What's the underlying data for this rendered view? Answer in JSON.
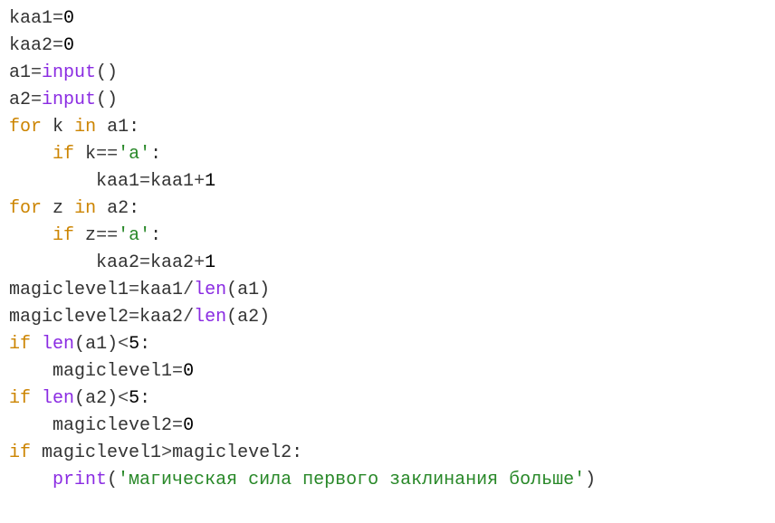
{
  "code": {
    "lines": [
      {
        "indent": 0,
        "tokens": [
          {
            "t": "kaa1",
            "c": "var"
          },
          {
            "t": "=",
            "c": "op"
          },
          {
            "t": "0",
            "c": "num"
          }
        ]
      },
      {
        "indent": 0,
        "tokens": [
          {
            "t": "kaa2",
            "c": "var"
          },
          {
            "t": "=",
            "c": "op"
          },
          {
            "t": "0",
            "c": "num"
          }
        ]
      },
      {
        "indent": 0,
        "tokens": [
          {
            "t": "a1",
            "c": "var"
          },
          {
            "t": "=",
            "c": "op"
          },
          {
            "t": "input",
            "c": "func"
          },
          {
            "t": "()",
            "c": "punc"
          }
        ]
      },
      {
        "indent": 0,
        "tokens": [
          {
            "t": "a2",
            "c": "var"
          },
          {
            "t": "=",
            "c": "op"
          },
          {
            "t": "input",
            "c": "func"
          },
          {
            "t": "()",
            "c": "punc"
          }
        ]
      },
      {
        "indent": 0,
        "tokens": [
          {
            "t": "for",
            "c": "kw"
          },
          {
            "t": " ",
            "c": "var"
          },
          {
            "t": "k",
            "c": "var"
          },
          {
            "t": " ",
            "c": "var"
          },
          {
            "t": "in",
            "c": "kw"
          },
          {
            "t": " ",
            "c": "var"
          },
          {
            "t": "a1",
            "c": "var"
          },
          {
            "t": ":",
            "c": "punc"
          }
        ]
      },
      {
        "indent": 1,
        "tokens": [
          {
            "t": "if",
            "c": "kw"
          },
          {
            "t": " ",
            "c": "var"
          },
          {
            "t": "k",
            "c": "var"
          },
          {
            "t": "==",
            "c": "op"
          },
          {
            "t": "'a'",
            "c": "str"
          },
          {
            "t": ":",
            "c": "punc"
          }
        ]
      },
      {
        "indent": 2,
        "tokens": [
          {
            "t": "kaa1",
            "c": "var"
          },
          {
            "t": "=",
            "c": "op"
          },
          {
            "t": "kaa1",
            "c": "var"
          },
          {
            "t": "+",
            "c": "op"
          },
          {
            "t": "1",
            "c": "num"
          }
        ]
      },
      {
        "indent": 0,
        "tokens": [
          {
            "t": "for",
            "c": "kw"
          },
          {
            "t": " ",
            "c": "var"
          },
          {
            "t": "z",
            "c": "var"
          },
          {
            "t": " ",
            "c": "var"
          },
          {
            "t": "in",
            "c": "kw"
          },
          {
            "t": " ",
            "c": "var"
          },
          {
            "t": "a2",
            "c": "var"
          },
          {
            "t": ":",
            "c": "punc"
          }
        ]
      },
      {
        "indent": 1,
        "tokens": [
          {
            "t": "if",
            "c": "kw"
          },
          {
            "t": " ",
            "c": "var"
          },
          {
            "t": "z",
            "c": "var"
          },
          {
            "t": "==",
            "c": "op"
          },
          {
            "t": "'a'",
            "c": "str"
          },
          {
            "t": ":",
            "c": "punc"
          }
        ]
      },
      {
        "indent": 2,
        "tokens": [
          {
            "t": "kaa2",
            "c": "var"
          },
          {
            "t": "=",
            "c": "op"
          },
          {
            "t": "kaa2",
            "c": "var"
          },
          {
            "t": "+",
            "c": "op"
          },
          {
            "t": "1",
            "c": "num"
          }
        ]
      },
      {
        "indent": 0,
        "tokens": [
          {
            "t": "magiclevel1",
            "c": "var"
          },
          {
            "t": "=",
            "c": "op"
          },
          {
            "t": "kaa1",
            "c": "var"
          },
          {
            "t": "/",
            "c": "op"
          },
          {
            "t": "len",
            "c": "func"
          },
          {
            "t": "(",
            "c": "punc"
          },
          {
            "t": "a1",
            "c": "var"
          },
          {
            "t": ")",
            "c": "punc"
          }
        ]
      },
      {
        "indent": 0,
        "tokens": [
          {
            "t": "magiclevel2",
            "c": "var"
          },
          {
            "t": "=",
            "c": "op"
          },
          {
            "t": "kaa2",
            "c": "var"
          },
          {
            "t": "/",
            "c": "op"
          },
          {
            "t": "len",
            "c": "func"
          },
          {
            "t": "(",
            "c": "punc"
          },
          {
            "t": "a2",
            "c": "var"
          },
          {
            "t": ")",
            "c": "punc"
          }
        ]
      },
      {
        "indent": 0,
        "tokens": [
          {
            "t": "if",
            "c": "kw"
          },
          {
            "t": " ",
            "c": "var"
          },
          {
            "t": "len",
            "c": "func"
          },
          {
            "t": "(",
            "c": "punc"
          },
          {
            "t": "a1",
            "c": "var"
          },
          {
            "t": ")",
            "c": "punc"
          },
          {
            "t": "<",
            "c": "op"
          },
          {
            "t": "5",
            "c": "num"
          },
          {
            "t": ":",
            "c": "punc"
          }
        ]
      },
      {
        "indent": 1,
        "tokens": [
          {
            "t": "magiclevel1",
            "c": "var"
          },
          {
            "t": "=",
            "c": "op"
          },
          {
            "t": "0",
            "c": "num"
          }
        ]
      },
      {
        "indent": 0,
        "tokens": [
          {
            "t": "if",
            "c": "kw"
          },
          {
            "t": " ",
            "c": "var"
          },
          {
            "t": "len",
            "c": "func"
          },
          {
            "t": "(",
            "c": "punc"
          },
          {
            "t": "a2",
            "c": "var"
          },
          {
            "t": ")",
            "c": "punc"
          },
          {
            "t": "<",
            "c": "op"
          },
          {
            "t": "5",
            "c": "num"
          },
          {
            "t": ":",
            "c": "punc"
          }
        ]
      },
      {
        "indent": 1,
        "tokens": [
          {
            "t": "magiclevel2",
            "c": "var"
          },
          {
            "t": "=",
            "c": "op"
          },
          {
            "t": "0",
            "c": "num"
          }
        ]
      },
      {
        "indent": 0,
        "tokens": [
          {
            "t": "if",
            "c": "kw"
          },
          {
            "t": " ",
            "c": "var"
          },
          {
            "t": "magiclevel1",
            "c": "var"
          },
          {
            "t": ">",
            "c": "op"
          },
          {
            "t": "magiclevel2",
            "c": "var"
          },
          {
            "t": ":",
            "c": "punc"
          }
        ]
      },
      {
        "indent": 1,
        "tokens": [
          {
            "t": "print",
            "c": "func"
          },
          {
            "t": "(",
            "c": "punc"
          },
          {
            "t": "'магическая сила первого заклинания больше'",
            "c": "str"
          },
          {
            "t": ")",
            "c": "punc"
          }
        ]
      }
    ]
  },
  "settings": {
    "indent_unit": "    "
  }
}
